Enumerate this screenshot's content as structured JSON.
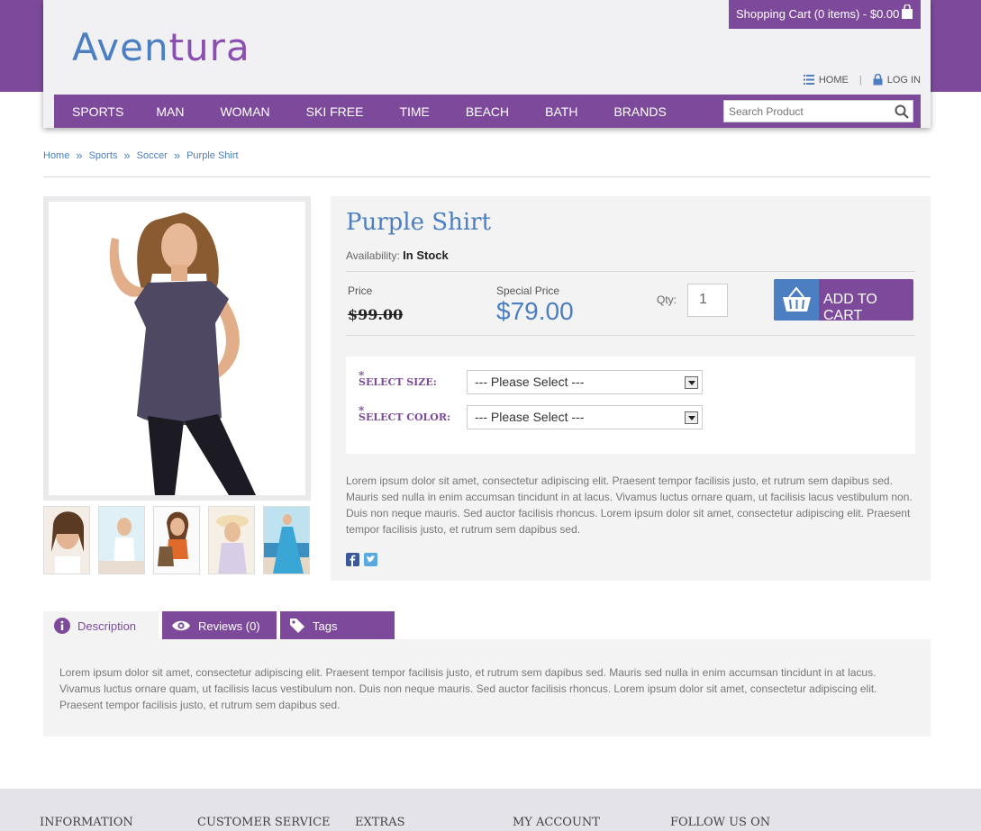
{
  "brand": {
    "logo_part1": "Aven",
    "logo_part2": "tura"
  },
  "header": {
    "cart_label": "Shopping Cart (0 items) - $0.00",
    "home_link": "HOME",
    "login_link": "LOG IN",
    "separator": "|"
  },
  "nav": {
    "items": [
      "SPORTS",
      "MAN",
      "WOMAN",
      "SKI FREE",
      "TIME",
      "BEACH",
      "BATH",
      "BRANDS"
    ],
    "search_placeholder": "Search Product"
  },
  "breadcrumb": {
    "items": [
      "Home",
      "Sports",
      "Soccer",
      "Purple Shirt"
    ],
    "separator": "»"
  },
  "product": {
    "title": "Purple Shirt",
    "availability_label": "Availability:",
    "availability_value": "In Stock",
    "price_label": "Price",
    "old_price": "$99.00",
    "special_price_label": "Special Price",
    "special_price": "$79.00",
    "qty_label": "Qty:",
    "qty_value": "1",
    "add_to_cart_label": "ADD TO CART",
    "required_mark": "*",
    "size_label": "SELECT SIZE:",
    "size_selected": "--- Please Select ---",
    "color_label": "SELECT COLOR:",
    "color_selected": "--- Please Select ---",
    "short_description": "Lorem ipsum dolor sit amet, consectetur adipiscing elit. Praesent tempor facilisis justo, et rutrum sem dapibus sed. Mauris sed nulla in enim accumsan tincidunt in at lacus. Vivamus luctus ornare quam, ut facilisis lacus vestibulum non. Duis non neque mauris. Sed auctor facilisis rhoncus. Lorem ipsum dolor sit amet, consectetur adipiscing elit. Praesent tempor facilisis justo, et rutrum sem dapibus sed."
  },
  "tabs": {
    "description": "Description",
    "reviews": "Reviews (0)",
    "tags": "Tags",
    "panel_text": "Lorem ipsum dolor sit amet, consectetur adipiscing elit. Praesent tempor facilisis justo, et rutrum sem dapibus sed. Mauris sed nulla in enim accumsan tincidunt in at lacus. Vivamus luctus ornare quam, ut facilisis lacus vestibulum non. Duis non neque mauris. Sed auctor facilisis rhoncus. Lorem ipsum dolor sit amet, consectetur adipiscing elit. Praesent tempor facilisis justo, et rutrum sem dapibus sed."
  },
  "footer": {
    "columns": [
      "INFORMATION",
      "CUSTOMER SERVICE",
      "EXTRAS",
      "MY ACCOUNT",
      "FOLLOW US ON"
    ]
  },
  "colors": {
    "brand_purple": "#7d4a9b",
    "brand_blue": "#4b7fc2",
    "panel_gray": "#f3f3f4"
  },
  "icons": [
    "shopping-bag-icon",
    "list-icon",
    "lock-icon",
    "search-icon",
    "basket-icon",
    "facebook-icon",
    "twitter-icon",
    "info-icon",
    "eye-icon",
    "tag-icon"
  ]
}
